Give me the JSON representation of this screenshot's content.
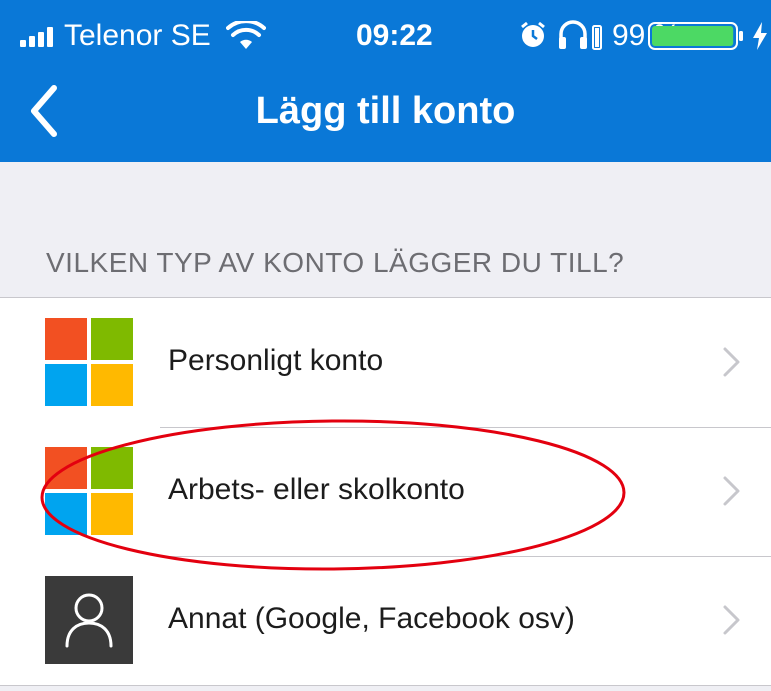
{
  "status_bar": {
    "carrier": "Telenor SE",
    "time": "09:22",
    "battery_percent": "99 %",
    "battery_level": 0.99,
    "icons": [
      "signal-icon",
      "wifi-icon",
      "alarm-icon",
      "headphones-icon",
      "battery-icon",
      "charging-icon"
    ]
  },
  "nav": {
    "title": "Lägg till konto",
    "back_icon": "back-chevron-icon"
  },
  "section": {
    "header": "VILKEN TYP AV KONTO LÄGGER DU TILL?"
  },
  "accounts": [
    {
      "label": "Personligt konto",
      "icon": "microsoft-logo-icon"
    },
    {
      "label": "Arbets- eller skolkonto",
      "icon": "microsoft-logo-icon"
    },
    {
      "label": "Annat (Google, Facebook osv)",
      "icon": "person-icon"
    }
  ],
  "colors": {
    "header_blue": "#0a78d7",
    "ms_red": "#f25022",
    "ms_green": "#7fba00",
    "ms_blue": "#00a4ef",
    "ms_yellow": "#ffb900",
    "annotation_red": "#e3000f",
    "battery_green": "#4cd964"
  }
}
